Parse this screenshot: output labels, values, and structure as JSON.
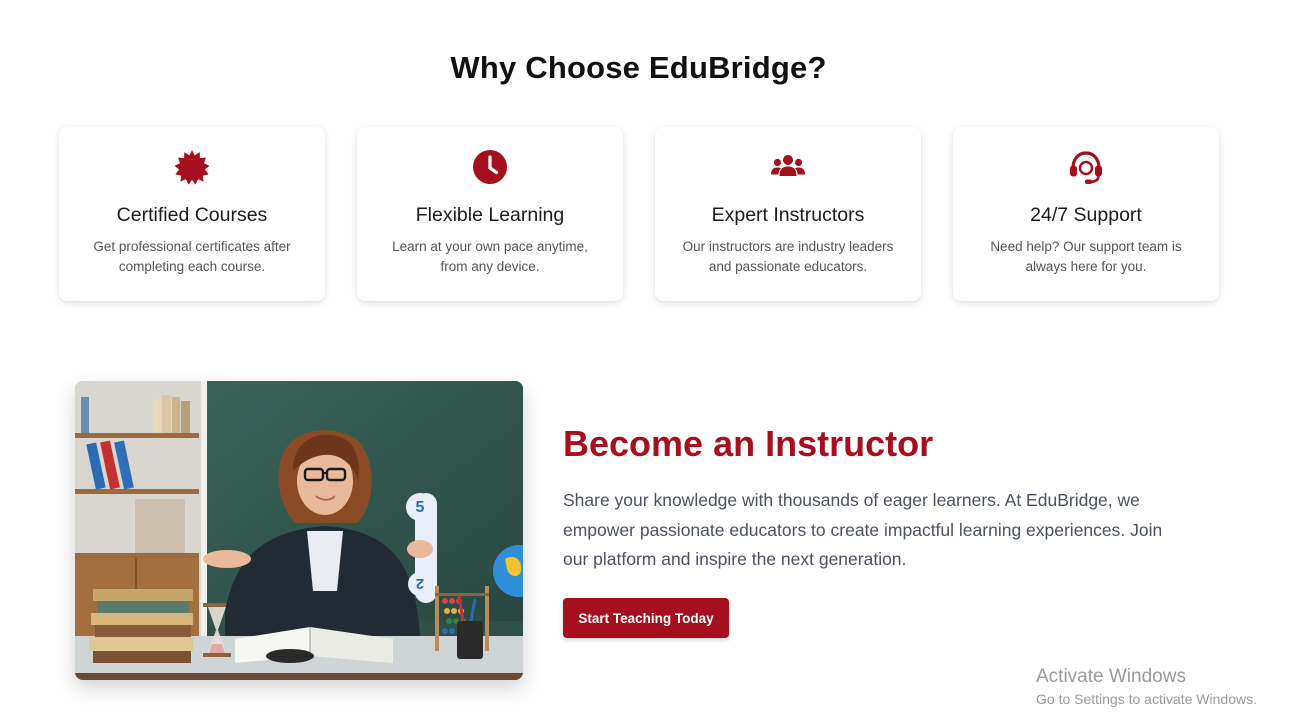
{
  "section": {
    "title": "Why Choose EduBridge?"
  },
  "features": [
    {
      "title": "Certified Courses",
      "desc_line1": "Get professional certificates after",
      "desc_line2": "completing each course.",
      "icon": "certificate-icon"
    },
    {
      "title": "Flexible Learning",
      "desc_line1": "Learn at your own pace anytime,",
      "desc_line2": "from any device.",
      "icon": "clock-icon"
    },
    {
      "title": "Expert Instructors",
      "desc_line1": "Our instructors are industry leaders",
      "desc_line2": "and passionate educators.",
      "icon": "users-icon"
    },
    {
      "title": "24/7 Support",
      "desc_line1": "Need help? Our support team is",
      "desc_line2": "always here for you.",
      "icon": "headset-icon"
    }
  ],
  "instructor": {
    "title": "Become an Instructor",
    "line1": "Share your knowledge with thousands of eager learners. At EduBridge, we",
    "line2": "empower passionate educators to create impactful learning experiences. Join",
    "line3": "our platform and inspire the next generation.",
    "button_label": "Start Teaching Today",
    "image_card_5": "5",
    "image_card_2": "2"
  },
  "watermark": {
    "title": "Activate Windows",
    "subtitle": "Go to Settings to activate Windows."
  },
  "colors": {
    "accent": "#a50f1e",
    "text_muted": "#4b5160",
    "heading": "#111111"
  }
}
